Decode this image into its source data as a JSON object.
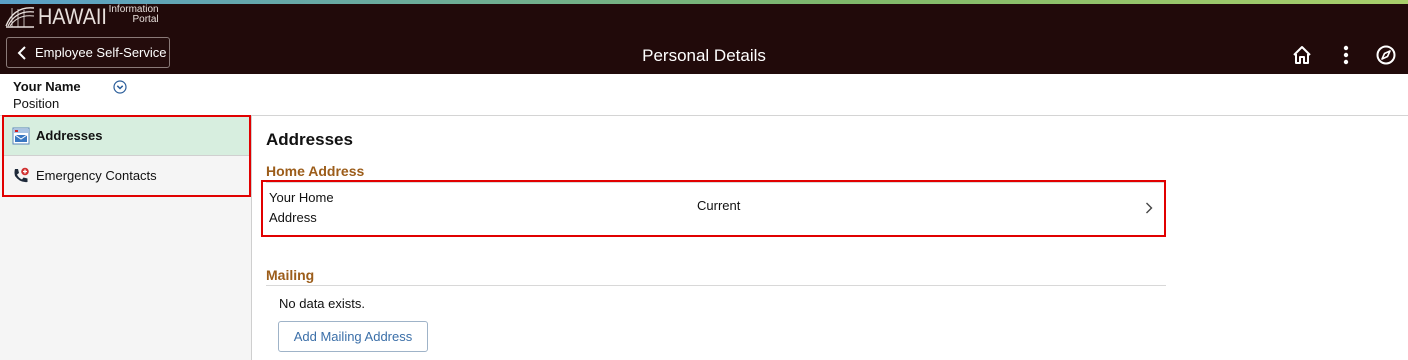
{
  "header": {
    "logo_word": "HAWAII",
    "logo_sub_line1": "Information",
    "logo_sub_line2": "Portal",
    "back_label": "Employee Self-Service",
    "title": "Personal Details",
    "icons": [
      "home-icon",
      "more-vertical-icon",
      "navigator-compass-icon"
    ]
  },
  "user": {
    "name": "Your Name",
    "position": "Position"
  },
  "sidebar": {
    "items": [
      {
        "label": "Addresses",
        "icon": "address-card-icon",
        "active": true
      },
      {
        "label": "Emergency Contacts",
        "icon": "phone-contact-icon",
        "active": false
      }
    ]
  },
  "main": {
    "title": "Addresses",
    "home": {
      "heading": "Home Address",
      "address_line1": "Your Home",
      "address_line2": "Address",
      "status": "Current"
    },
    "mailing": {
      "heading": "Mailing",
      "empty_text": "No data exists.",
      "add_label": "Add Mailing Address"
    }
  },
  "colors": {
    "banner": "#210a0a",
    "accent_heading": "#9c5d1a",
    "active_nav": "#d7eedf",
    "highlight_box": "#e10000",
    "link_blue": "#3b6fa8"
  }
}
